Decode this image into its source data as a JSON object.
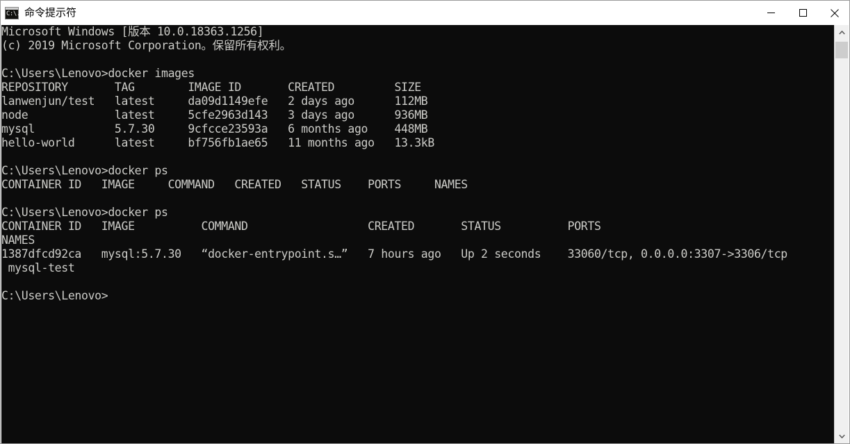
{
  "window": {
    "title": "命令提示符",
    "icon_label": "C:\\.",
    "controls": {
      "minimize": "—",
      "maximize": "□",
      "close": "✕"
    }
  },
  "console": {
    "background_color": "#0c0c0c",
    "text_color": "#ccccc8",
    "lines": [
      "Microsoft Windows [版本 10.0.18363.1256]",
      "(c) 2019 Microsoft Corporation。保留所有权利。",
      "",
      "C:\\Users\\Lenovo>docker images",
      "REPOSITORY       TAG        IMAGE ID       CREATED         SIZE",
      "lanwenjun/test   latest     da09d1149efe   2 days ago      112MB",
      "node             latest     5cfe2963d143   3 days ago      936MB",
      "mysql            5.7.30     9cfcce23593a   6 months ago    448MB",
      "hello-world      latest     bf756fb1ae65   11 months ago   13.3kB",
      "",
      "C:\\Users\\Lenovo>docker ps",
      "CONTAINER ID   IMAGE     COMMAND   CREATED   STATUS    PORTS     NAMES",
      "",
      "C:\\Users\\Lenovo>docker ps",
      "CONTAINER ID   IMAGE          COMMAND                  CREATED       STATUS          PORTS",
      "NAMES",
      "1387dfcd92ca   mysql:5.7.30   “docker-entrypoint.s…”   7 hours ago   Up 2 seconds    33060/tcp, 0.0.0.0:3307->3306/tcp",
      " mysql-test",
      "",
      "C:\\Users\\Lenovo>"
    ],
    "commands": [
      "docker images",
      "docker ps",
      "docker ps"
    ],
    "prompt": "C:\\Users\\Lenovo>",
    "docker_images": {
      "headers": [
        "REPOSITORY",
        "TAG",
        "IMAGE ID",
        "CREATED",
        "SIZE"
      ],
      "rows": [
        [
          "lanwenjun/test",
          "latest",
          "da09d1149efe",
          "2 days ago",
          "112MB"
        ],
        [
          "node",
          "latest",
          "5cfe2963d143",
          "3 days ago",
          "936MB"
        ],
        [
          "mysql",
          "5.7.30",
          "9cfcce23593a",
          "6 months ago",
          "448MB"
        ],
        [
          "hello-world",
          "latest",
          "bf756fb1ae65",
          "11 months ago",
          "13.3kB"
        ]
      ]
    },
    "docker_ps_first": {
      "headers": [
        "CONTAINER ID",
        "IMAGE",
        "COMMAND",
        "CREATED",
        "STATUS",
        "PORTS",
        "NAMES"
      ],
      "rows": []
    },
    "docker_ps_second": {
      "headers": [
        "CONTAINER ID",
        "IMAGE",
        "COMMAND",
        "CREATED",
        "STATUS",
        "PORTS",
        "NAMES"
      ],
      "rows": [
        [
          "1387dfcd92ca",
          "mysql:5.7.30",
          "“docker-entrypoint.s…”",
          "7 hours ago",
          "Up 2 seconds",
          "33060/tcp, 0.0.0.0:3307->3306/tcp",
          "mysql-test"
        ]
      ]
    }
  },
  "scrollbar": {
    "up_arrow": "⌃",
    "down_arrow": "⌄"
  }
}
